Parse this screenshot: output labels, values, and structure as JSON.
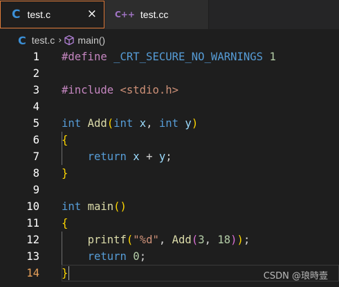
{
  "tabs": [
    {
      "icon": "c-file-icon",
      "glyph": "C",
      "label": "test.c",
      "active": true,
      "close": "×"
    },
    {
      "icon": "cpp-file-icon",
      "glyph": "C++",
      "label": "test.cc",
      "active": false
    }
  ],
  "breadcrumb": {
    "file": "test.c",
    "file_glyph": "C",
    "separator": "›",
    "symbol": "main()"
  },
  "editor": {
    "current_line": 14,
    "lines": [
      {
        "n": "1",
        "text": "#define _CRT_SECURE_NO_WARNINGS 1"
      },
      {
        "n": "2",
        "text": ""
      },
      {
        "n": "3",
        "text": "#include <stdio.h>"
      },
      {
        "n": "4",
        "text": ""
      },
      {
        "n": "5",
        "text": "int Add(int x, int y)"
      },
      {
        "n": "6",
        "text": "{"
      },
      {
        "n": "7",
        "text": "    return x + y;"
      },
      {
        "n": "8",
        "text": "}"
      },
      {
        "n": "9",
        "text": ""
      },
      {
        "n": "10",
        "text": "int main()"
      },
      {
        "n": "11",
        "text": "{"
      },
      {
        "n": "12",
        "text": "    printf(\"%d\", Add(3, 18));"
      },
      {
        "n": "13",
        "text": "    return 0;"
      },
      {
        "n": "14",
        "text": "}"
      }
    ]
  },
  "watermark": "CSDN @琅時壹"
}
